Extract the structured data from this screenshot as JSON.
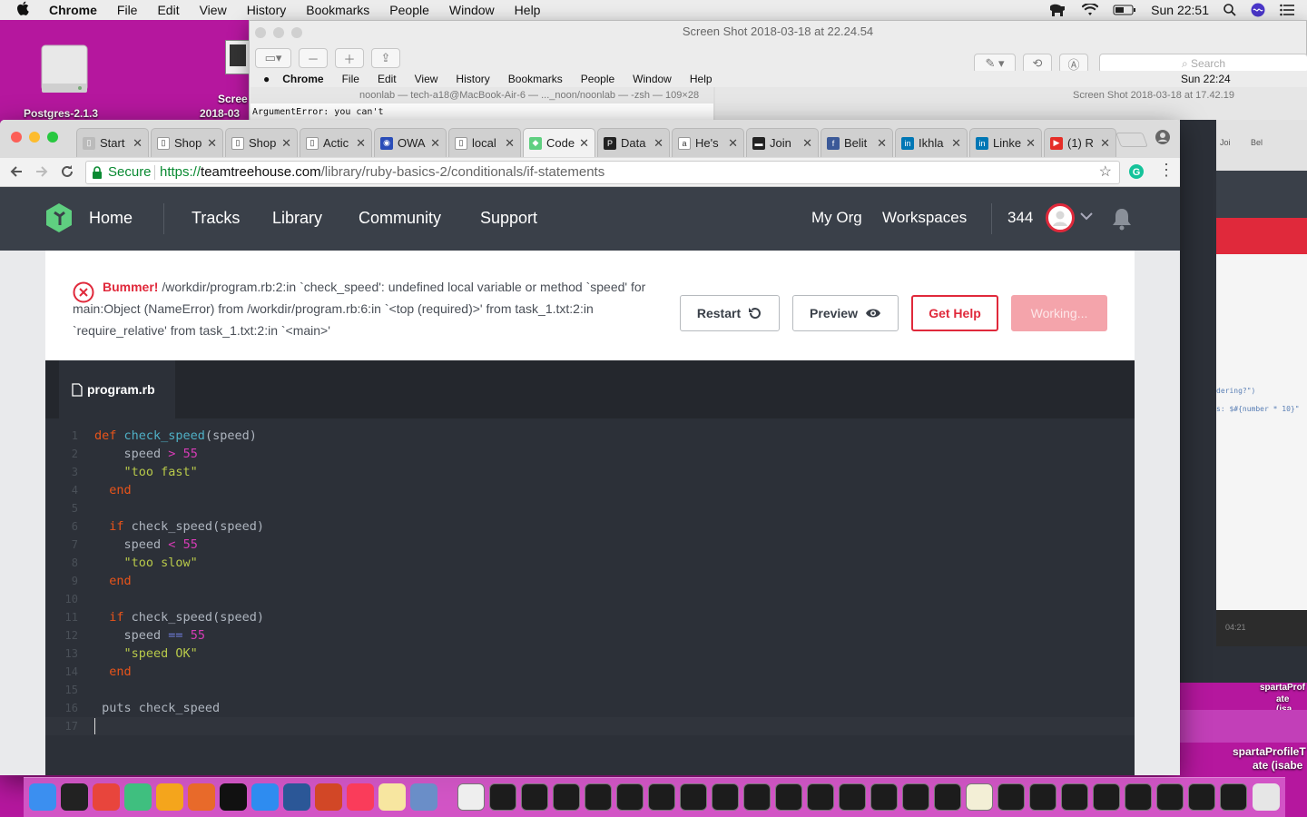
{
  "mac_menubar": {
    "app": "Chrome",
    "items": [
      "File",
      "Edit",
      "View",
      "History",
      "Bookmarks",
      "People",
      "Window",
      "Help"
    ],
    "clock": "Sun 22:51"
  },
  "desktop": {
    "icon1_label": "Postgres-2.1.3",
    "icon2_label_line1": "Scree",
    "icon2_label_line2": "2018-03"
  },
  "preview_window": {
    "title": "Screen Shot 2018-03-18 at 22.24.54",
    "search_placeholder": "Search"
  },
  "inner_screenshot": {
    "app": "Chrome",
    "menu_items": [
      "File",
      "Edit",
      "View",
      "History",
      "Bookmarks",
      "People",
      "Window",
      "Help"
    ],
    "clock": "Sun 22:24",
    "terminal_title": "noonlab — tech-a18@MacBook-Air-6 — ..._noon/noonlab — -zsh — 109×28",
    "terminal_line": "ArgumentError: you can't",
    "preview_title": "Screen Shot 2018-03-18 at 17.42.19",
    "side_code1": "dering?\")",
    "side_code2": "s: $#{number * 10}\"",
    "side_time": "04:21",
    "side_tab1": "Joi",
    "side_tab2": "Bel"
  },
  "desktop_right": {
    "label1_line1": "spartaProf",
    "label1_line2": "ate (isa",
    "label2_line1": "spartaProfileT",
    "label2_line2": "ate (isabe"
  },
  "browser": {
    "tabs": [
      {
        "label": "Start",
        "favicon": "page"
      },
      {
        "label": "Shop",
        "favicon": "doc"
      },
      {
        "label": "Shop",
        "favicon": "doc"
      },
      {
        "label": "Actic",
        "favicon": "doc"
      },
      {
        "label": "OWA",
        "favicon": "globe"
      },
      {
        "label": "local",
        "favicon": "doc"
      },
      {
        "label": "Code",
        "favicon": "treehouse"
      },
      {
        "label": "Data",
        "favicon": "p"
      },
      {
        "label": "He's",
        "favicon": "amazon"
      },
      {
        "label": "Join",
        "favicon": "dark"
      },
      {
        "label": "Belit",
        "favicon": "facebook"
      },
      {
        "label": "Ikhla",
        "favicon": "linkedin"
      },
      {
        "label": "Linke",
        "favicon": "linkedin"
      },
      {
        "label": "(1) R",
        "favicon": "youtube"
      }
    ],
    "secure_label": "Secure",
    "url_scheme": "https://",
    "url_host": "teamtreehouse.com",
    "url_path": "/library/ruby-basics-2/conditionals/if-statements"
  },
  "site_nav": {
    "home": "Home",
    "links": [
      "Tracks",
      "Library",
      "Community",
      "Support"
    ],
    "right_links": [
      "My Org",
      "Workspaces"
    ],
    "points": "344"
  },
  "error": {
    "title": "Bummer!",
    "message": "/workdir/program.rb:2:in `check_speed': undefined local variable or method `speed' for main:Object (NameError) from /workdir/program.rb:6:in `<top (required)>' from task_1.txt:2:in `require_relative' from task_1.txt:2:in `<main>'"
  },
  "buttons": {
    "restart": "Restart",
    "preview": "Preview",
    "get_help": "Get Help",
    "working": "Working..."
  },
  "editor": {
    "filename": "program.rb",
    "lines": [
      "def check_speed(speed)",
      "    speed > 55",
      "    \"too fast\"",
      "  end",
      "",
      "  if check_speed(speed)",
      "    speed < 55",
      "    \"too slow\"",
      "  end",
      "",
      "  if check_speed(speed)",
      "    speed == 55",
      "    \"speed OK\"",
      "  end",
      "",
      " puts check_speed",
      ""
    ]
  },
  "colors": {
    "nav_bg": "#3a4049",
    "editor_bg": "#2c3038",
    "error_red": "#e0293b",
    "working_pink": "#f4a4ab",
    "treehouse_green": "#5fcf80",
    "desktop_magenta": "#b5179e"
  }
}
